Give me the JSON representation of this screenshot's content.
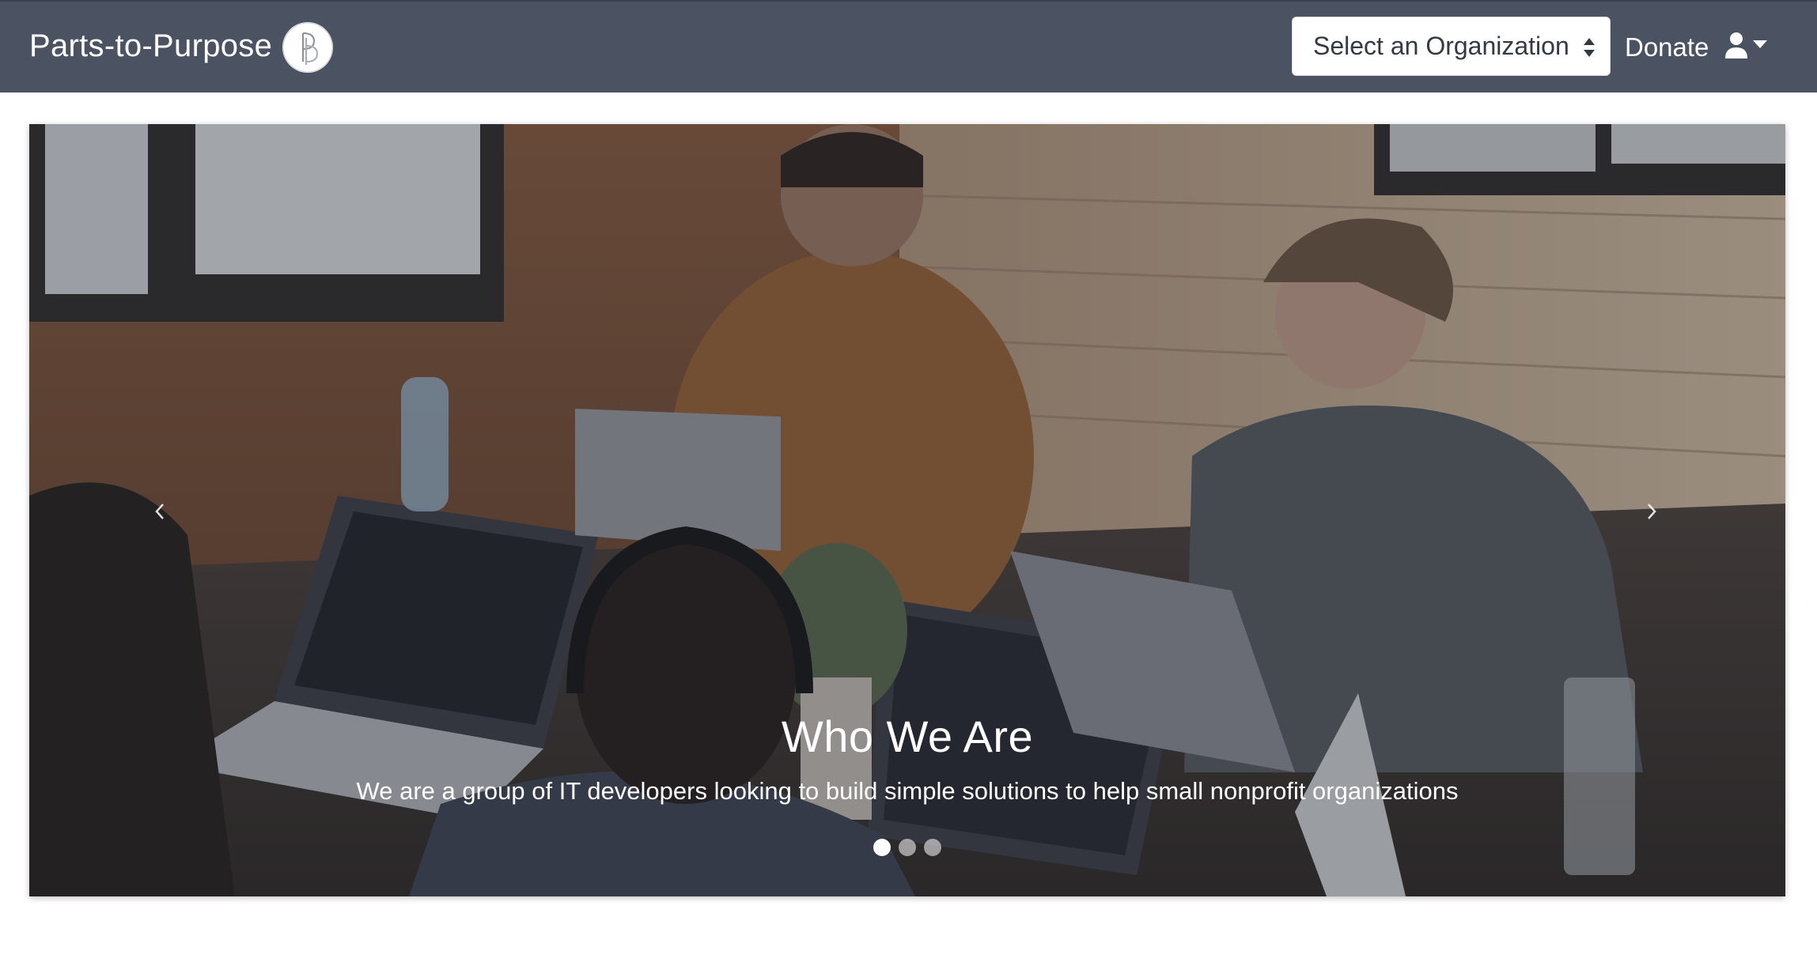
{
  "navbar": {
    "brand": "Parts-to-Purpose",
    "logo_icon": "parts-to-purpose-logo-icon",
    "org_select": {
      "selected": "Select an Organization"
    },
    "donate_label": "Donate",
    "user_icon": "user-icon",
    "dropdown_icon": "caret-down-icon",
    "background_color": "#4b5261"
  },
  "carousel": {
    "slide_image": "team-of-developers-at-laptops-photo",
    "caption_title": "Who We Are",
    "caption_text": "We are a group of IT developers looking to build simple solutions to help small nonprofit organizations",
    "prev_icon": "chevron-left-icon",
    "next_icon": "chevron-right-icon",
    "indicators": [
      {
        "active": true
      },
      {
        "active": false
      },
      {
        "active": false
      }
    ]
  }
}
